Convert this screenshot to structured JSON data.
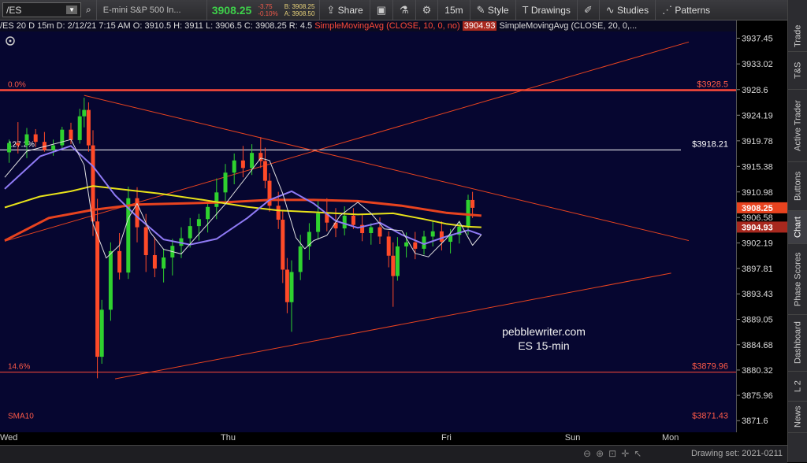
{
  "toolbar": {
    "symbol": "/ES",
    "description": "E-mini S&P 500 In...",
    "last_price": "3908.25",
    "change": "-3.75",
    "change_pct": "-0.10%",
    "bid": "B: 3908.25",
    "ask": "A: 3908.50",
    "share_label": "Share",
    "timeframe": "15m",
    "style_label": "Style",
    "drawings_label": "Drawings",
    "studies_label": "Studies",
    "patterns_label": "Patterns"
  },
  "infobar": {
    "symbol_tf": "/ES 20 D 15m",
    "date": "D: 2/12/21 7:15 AM",
    "open": "O: 3910.5",
    "high": "H: 3911",
    "low": "L: 3906.5",
    "close": "C: 3908.25",
    "range": "R: 4.5",
    "sma1": "SimpleMovingAvg (CLOSE, 10, 0, no)",
    "sma1_val": "3904.93",
    "sma2": "SimpleMovingAvg (CLOSE, 20, 0,..."
  },
  "sidebar": [
    "Trade",
    "T&S",
    "Active Trader",
    "Buttons",
    "Chart",
    "Phase Scores",
    "Dashboard",
    "L 2",
    "News"
  ],
  "bottom": {
    "drawing_set": "Drawing set: 2021-0211"
  },
  "chart_data": {
    "type": "line",
    "ylim": [
      3869.6,
      3940.5
    ],
    "y_ticks": [
      "3937.45",
      "3933.02",
      "3928.6",
      "3924.19",
      "3919.78",
      "3915.38",
      "3910.98",
      "3906.58",
      "3902.19",
      "3897.81",
      "3893.43",
      "3889.05",
      "3884.68",
      "3880.32",
      "3875.96",
      "3871.6"
    ],
    "x_labels": [
      {
        "label": "Wed",
        "x": 0
      },
      {
        "label": "Thu",
        "x": 50
      },
      {
        "label": "Fri",
        "x": 100
      },
      {
        "label": "Sun",
        "x": 128
      },
      {
        "label": "Mon",
        "x": 150
      }
    ],
    "price_markers": [
      {
        "value": 3908.25,
        "label": "3908.25",
        "color": "#e8431f"
      },
      {
        "value": 3904.93,
        "label": "3904.93",
        "color": "#a8281e"
      }
    ],
    "horizontal_lines": [
      {
        "value": 3928.5,
        "left_label": "0.0%",
        "right_label": "$3928.5",
        "color": "#ff4a3a",
        "width": 2.5
      },
      {
        "value": 3918.21,
        "left_label": "127.2%",
        "right_label": "$3918.21",
        "color": "#ffffff",
        "width": 1
      },
      {
        "value": 3879.96,
        "left_label": "14.6%",
        "right_label": "$3879.96",
        "color": "#ff4a3a",
        "width": 1
      },
      {
        "value": 3871.43,
        "left_label": "SMA10",
        "right_label": "$3871.43",
        "color": "#ff4a3a",
        "width": 0
      }
    ],
    "trendlines": [
      {
        "name": "upper-down",
        "from": [
          18,
          3927.6
        ],
        "to": [
          155,
          3902.6
        ],
        "color": "#e8431f"
      },
      {
        "name": "rising",
        "from": [
          0,
          3902.5
        ],
        "to": [
          155,
          3936.8
        ],
        "color": "#e8431f"
      },
      {
        "name": "lower-up",
        "from": [
          25,
          3878.8
        ],
        "to": [
          151,
          3897.0
        ],
        "color": "#e8431f"
      }
    ],
    "series": [
      {
        "name": "SMA (CLOSE, 10)",
        "color": "#e8431f",
        "width": 3,
        "x": [
          0,
          10,
          20,
          30,
          40,
          50,
          55,
          60,
          70,
          80,
          90,
          100,
          108
        ],
        "y": [
          3902.6,
          3906.5,
          3907.9,
          3908.8,
          3909.0,
          3909.2,
          3909.4,
          3909.6,
          3909.6,
          3909.4,
          3908.6,
          3907.4,
          3906.9
        ]
      },
      {
        "name": "SMA (CLOSE, 20)",
        "color": "#e8e21a",
        "width": 2,
        "x": [
          0,
          8,
          15,
          20,
          28,
          35,
          45,
          55,
          62,
          70,
          80,
          88,
          95,
          100,
          105,
          108
        ],
        "y": [
          3908.3,
          3910.2,
          3911.1,
          3912.0,
          3911.3,
          3910.7,
          3909.6,
          3908.4,
          3907.8,
          3907.5,
          3907.1,
          3907.3,
          3906.3,
          3905.5,
          3905.0,
          3904.9
        ]
      },
      {
        "name": "SMA slow",
        "color": "#8f7af5",
        "width": 2,
        "x": [
          0,
          8,
          15,
          20,
          25,
          30,
          36,
          42,
          48,
          55,
          60,
          65,
          70,
          75,
          80,
          85,
          90,
          95,
          100,
          105,
          108
        ],
        "y": [
          3911.5,
          3917.1,
          3918.9,
          3915.4,
          3910.4,
          3906.7,
          3902.8,
          3901.9,
          3902.9,
          3906.5,
          3909.6,
          3911.1,
          3909.0,
          3906.0,
          3904.8,
          3905.7,
          3903.6,
          3902.0,
          3903.3,
          3904.4,
          3903.6
        ]
      },
      {
        "name": "SMA fast",
        "color": "#e0e0e0",
        "width": 1,
        "x": [
          0,
          5,
          10,
          15,
          18,
          20,
          23,
          26,
          28,
          30,
          33,
          36,
          40,
          45,
          50,
          55,
          58,
          60,
          63,
          66,
          68,
          70,
          73,
          76,
          80,
          83,
          86,
          90,
          93,
          96,
          100,
          103,
          106,
          108
        ],
        "y": [
          3913.5,
          3918.0,
          3919.0,
          3920.0,
          3915.6,
          3905.5,
          3899.6,
          3901.8,
          3906.4,
          3909.0,
          3904.0,
          3901.1,
          3900.3,
          3904.6,
          3908.9,
          3913.8,
          3916.8,
          3916.4,
          3910.7,
          3903.1,
          3901.2,
          3902.6,
          3903.5,
          3906.9,
          3909.2,
          3907.3,
          3904.6,
          3904.3,
          3900.4,
          3899.8,
          3902.9,
          3905.9,
          3901.8,
          3903.6
        ]
      }
    ],
    "candles": [
      {
        "x": 1,
        "o": 3917.8,
        "h": 3920.0,
        "l": 3916.0,
        "c": 3919.4
      },
      {
        "x": 3,
        "o": 3919.4,
        "h": 3923.0,
        "l": 3917.6,
        "c": 3919.0
      },
      {
        "x": 5,
        "o": 3919.0,
        "h": 3922.0,
        "l": 3916.8,
        "c": 3920.9
      },
      {
        "x": 7,
        "o": 3920.9,
        "h": 3921.8,
        "l": 3918.7,
        "c": 3919.6
      },
      {
        "x": 9,
        "o": 3919.6,
        "h": 3921.3,
        "l": 3917.9,
        "c": 3918.2
      },
      {
        "x": 11,
        "o": 3918.2,
        "h": 3920.0,
        "l": 3917.2,
        "c": 3919.0
      },
      {
        "x": 13,
        "o": 3919.0,
        "h": 3922.2,
        "l": 3918.4,
        "c": 3921.7
      },
      {
        "x": 15,
        "o": 3921.7,
        "h": 3922.9,
        "l": 3919.2,
        "c": 3919.9
      },
      {
        "x": 17,
        "o": 3919.9,
        "h": 3925.3,
        "l": 3919.3,
        "c": 3924.0
      },
      {
        "x": 18,
        "o": 3924.0,
        "h": 3927.2,
        "l": 3922.1,
        "c": 3925.1
      },
      {
        "x": 19,
        "o": 3925.1,
        "h": 3926.4,
        "l": 3917.9,
        "c": 3919.0
      },
      {
        "x": 20,
        "o": 3919.0,
        "h": 3921.6,
        "l": 3903.4,
        "c": 3905.9
      },
      {
        "x": 21,
        "o": 3905.9,
        "h": 3909.8,
        "l": 3878.9,
        "c": 3882.6
      },
      {
        "x": 22,
        "o": 3882.6,
        "h": 3892.4,
        "l": 3881.4,
        "c": 3890.7
      },
      {
        "x": 24,
        "o": 3890.7,
        "h": 3902.3,
        "l": 3888.8,
        "c": 3900.8
      },
      {
        "x": 26,
        "o": 3900.8,
        "h": 3903.9,
        "l": 3895.9,
        "c": 3897.1
      },
      {
        "x": 28,
        "o": 3897.1,
        "h": 3911.9,
        "l": 3896.0,
        "c": 3909.9
      },
      {
        "x": 30,
        "o": 3909.9,
        "h": 3911.8,
        "l": 3902.3,
        "c": 3904.9
      },
      {
        "x": 32,
        "o": 3904.9,
        "h": 3907.2,
        "l": 3897.2,
        "c": 3900.1
      },
      {
        "x": 34,
        "o": 3900.1,
        "h": 3903.2,
        "l": 3896.3,
        "c": 3897.8
      },
      {
        "x": 36,
        "o": 3897.8,
        "h": 3901.2,
        "l": 3895.4,
        "c": 3899.7
      },
      {
        "x": 38,
        "o": 3899.7,
        "h": 3902.9,
        "l": 3896.6,
        "c": 3901.7
      },
      {
        "x": 40,
        "o": 3901.7,
        "h": 3904.9,
        "l": 3899.6,
        "c": 3903.0
      },
      {
        "x": 42,
        "o": 3903.0,
        "h": 3906.5,
        "l": 3901.4,
        "c": 3905.1
      },
      {
        "x": 44,
        "o": 3905.1,
        "h": 3907.2,
        "l": 3902.6,
        "c": 3906.3
      },
      {
        "x": 46,
        "o": 3906.3,
        "h": 3909.3,
        "l": 3904.0,
        "c": 3908.4
      },
      {
        "x": 48,
        "o": 3908.4,
        "h": 3913.3,
        "l": 3906.3,
        "c": 3910.9
      },
      {
        "x": 50,
        "o": 3910.9,
        "h": 3915.8,
        "l": 3909.2,
        "c": 3914.3
      },
      {
        "x": 52,
        "o": 3914.3,
        "h": 3917.6,
        "l": 3912.3,
        "c": 3916.4
      },
      {
        "x": 54,
        "o": 3916.4,
        "h": 3918.9,
        "l": 3913.5,
        "c": 3915.1
      },
      {
        "x": 56,
        "o": 3915.1,
        "h": 3919.2,
        "l": 3913.9,
        "c": 3917.7
      },
      {
        "x": 58,
        "o": 3917.7,
        "h": 3920.4,
        "l": 3915.1,
        "c": 3916.3
      },
      {
        "x": 59,
        "o": 3916.3,
        "h": 3918.6,
        "l": 3911.6,
        "c": 3912.9
      },
      {
        "x": 60,
        "o": 3912.9,
        "h": 3914.2,
        "l": 3907.6,
        "c": 3908.6
      },
      {
        "x": 62,
        "o": 3908.6,
        "h": 3911.0,
        "l": 3904.6,
        "c": 3906.2
      },
      {
        "x": 63,
        "o": 3906.2,
        "h": 3907.7,
        "l": 3895.3,
        "c": 3897.6
      },
      {
        "x": 64,
        "o": 3897.6,
        "h": 3899.6,
        "l": 3890.1,
        "c": 3892.0
      },
      {
        "x": 65,
        "o": 3892.0,
        "h": 3899.2,
        "l": 3886.9,
        "c": 3897.2
      },
      {
        "x": 67,
        "o": 3897.2,
        "h": 3903.6,
        "l": 3895.8,
        "c": 3901.6
      },
      {
        "x": 69,
        "o": 3901.6,
        "h": 3905.6,
        "l": 3899.3,
        "c": 3904.1
      },
      {
        "x": 71,
        "o": 3904.1,
        "h": 3909.5,
        "l": 3902.8,
        "c": 3907.3
      },
      {
        "x": 73,
        "o": 3907.3,
        "h": 3909.9,
        "l": 3904.2,
        "c": 3905.7
      },
      {
        "x": 75,
        "o": 3905.7,
        "h": 3908.2,
        "l": 3903.2,
        "c": 3904.7
      },
      {
        "x": 77,
        "o": 3904.7,
        "h": 3908.5,
        "l": 3903.5,
        "c": 3906.9
      },
      {
        "x": 79,
        "o": 3906.9,
        "h": 3908.2,
        "l": 3904.6,
        "c": 3905.3
      },
      {
        "x": 81,
        "o": 3905.3,
        "h": 3907.0,
        "l": 3902.5,
        "c": 3903.9
      },
      {
        "x": 83,
        "o": 3903.9,
        "h": 3905.6,
        "l": 3901.9,
        "c": 3904.9
      },
      {
        "x": 85,
        "o": 3904.9,
        "h": 3906.6,
        "l": 3902.0,
        "c": 3903.3
      },
      {
        "x": 87,
        "o": 3903.3,
        "h": 3904.2,
        "l": 3898.0,
        "c": 3900.0
      },
      {
        "x": 88,
        "o": 3900.0,
        "h": 3902.3,
        "l": 3891.2,
        "c": 3896.5
      },
      {
        "x": 89,
        "o": 3896.5,
        "h": 3903.2,
        "l": 3895.7,
        "c": 3901.6
      },
      {
        "x": 91,
        "o": 3901.6,
        "h": 3904.0,
        "l": 3899.7,
        "c": 3902.3
      },
      {
        "x": 93,
        "o": 3902.3,
        "h": 3904.1,
        "l": 3899.4,
        "c": 3901.2
      },
      {
        "x": 95,
        "o": 3901.2,
        "h": 3904.3,
        "l": 3900.2,
        "c": 3903.3
      },
      {
        "x": 97,
        "o": 3903.3,
        "h": 3905.9,
        "l": 3901.6,
        "c": 3904.2
      },
      {
        "x": 99,
        "o": 3904.2,
        "h": 3905.9,
        "l": 3900.9,
        "c": 3902.4
      },
      {
        "x": 101,
        "o": 3902.4,
        "h": 3904.6,
        "l": 3900.4,
        "c": 3903.6
      },
      {
        "x": 103,
        "o": 3903.6,
        "h": 3906.0,
        "l": 3902.1,
        "c": 3905.0
      },
      {
        "x": 105,
        "o": 3905.0,
        "h": 3910.5,
        "l": 3903.6,
        "c": 3909.6
      },
      {
        "x": 106,
        "o": 3909.6,
        "h": 3911.0,
        "l": 3906.5,
        "c": 3908.25
      }
    ],
    "annotation": [
      "pebblewriter.com",
      "ES 15-min"
    ]
  }
}
